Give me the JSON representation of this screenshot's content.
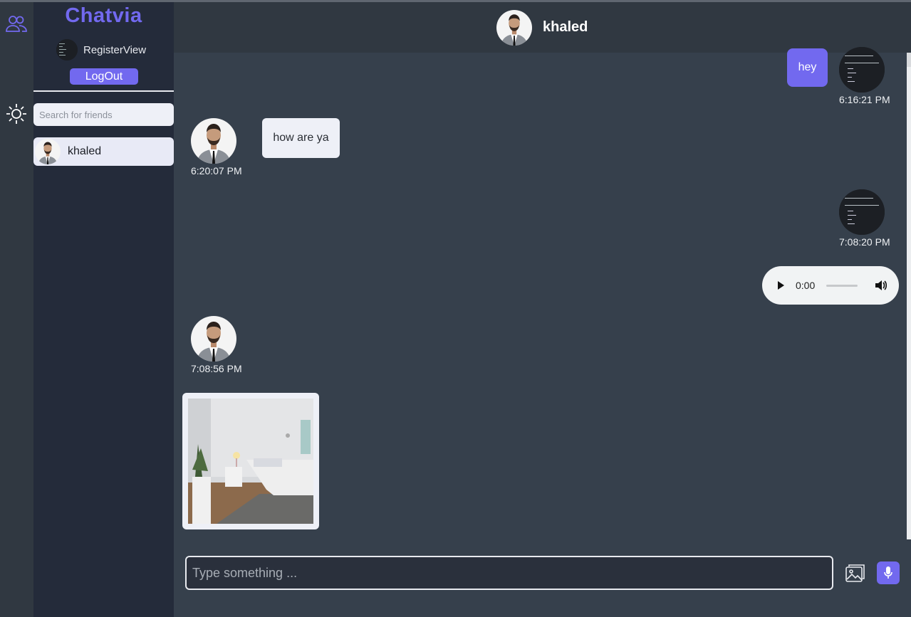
{
  "app": {
    "brand": "Chatvia",
    "accent": "#7269ef"
  },
  "rail": {
    "icons": [
      "users-icon",
      "sun-icon"
    ]
  },
  "sidebar": {
    "current_user": "RegisterView",
    "logout_label": "LogOut",
    "search_placeholder": "Search for friends",
    "friends": [
      {
        "name": "khaled"
      }
    ]
  },
  "header": {
    "contact_name": "khaled"
  },
  "messages": [
    {
      "side": "outgoing",
      "type": "text",
      "text": "hey",
      "time": "6:16:21 PM"
    },
    {
      "side": "incoming",
      "type": "text",
      "text": "how are ya",
      "time": "6:20:07 PM"
    },
    {
      "side": "outgoing",
      "type": "audio",
      "time": "7:08:20 PM",
      "audio_time": "0:00"
    },
    {
      "side": "incoming",
      "type": "image",
      "time": "7:08:56 PM",
      "image": "bedroom-photo"
    }
  ],
  "composer": {
    "placeholder": "Type something ...",
    "icons": [
      "image-icon",
      "mic-icon"
    ]
  }
}
